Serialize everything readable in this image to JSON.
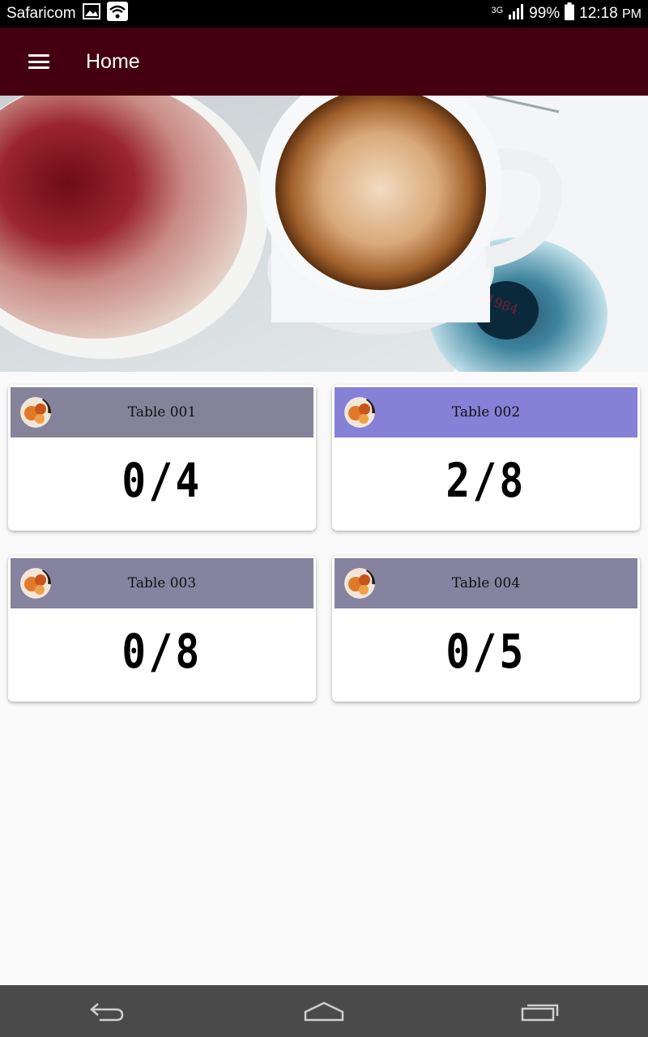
{
  "status_bar": {
    "carrier": "Safaricom",
    "network_type": "3G",
    "battery": "99%",
    "time": "12:18",
    "ampm": "PM",
    "icons": [
      "image-icon",
      "wifi-icon",
      "signal-icon",
      "battery-icon"
    ]
  },
  "app_bar": {
    "title": "Home",
    "menu_icon": "menu-icon",
    "background": "#44000e"
  },
  "hero": {
    "description_icon": "hero-image"
  },
  "tables": [
    {
      "label": "Table 001",
      "count": "0/4",
      "header_color": "#85839a"
    },
    {
      "label": "Table 002",
      "count": "2/8",
      "header_color": "#8481d6"
    },
    {
      "label": "Table 003",
      "count": "0/8",
      "header_color": "#85839f"
    },
    {
      "label": "Table 004",
      "count": "0/5",
      "header_color": "#85839f"
    }
  ],
  "nav_bar": {
    "icons": [
      "back-icon",
      "home-icon",
      "recents-icon"
    ]
  }
}
